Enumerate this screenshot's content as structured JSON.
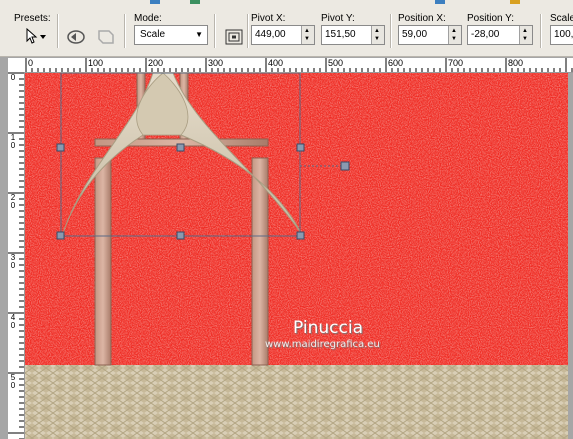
{
  "toolbar": {
    "presets_label": "Presets:",
    "mode_label": "Mode:",
    "mode_value": "Scale",
    "pivot_x_label": "Pivot X:",
    "pivot_x_value": "449,00",
    "pivot_y_label": "Pivot Y:",
    "pivot_y_value": "151,50",
    "position_x_label": "Position X:",
    "position_x_value": "59,00",
    "position_y_label": "Position Y:",
    "position_y_value": "-28,00",
    "scale_label": "Scale",
    "scale_value": "100,"
  },
  "ruler": {
    "top_labels": [
      "0",
      "100",
      "200",
      "300",
      "400",
      "500",
      "600",
      "700",
      "800"
    ],
    "left_labels": [
      "0",
      "1\n0",
      "2\n0",
      "3\n0",
      "4\n0",
      "5\n0"
    ]
  },
  "watermark": {
    "title": "Pinuccia",
    "url": "www.maidiregrafica.eu"
  },
  "colors": {
    "canvas_red": "#ef2a22",
    "floor": "#d8cdb6",
    "arch": "#cfc4aa",
    "pillar": "#b48a78",
    "selection": "#5a6a86"
  }
}
